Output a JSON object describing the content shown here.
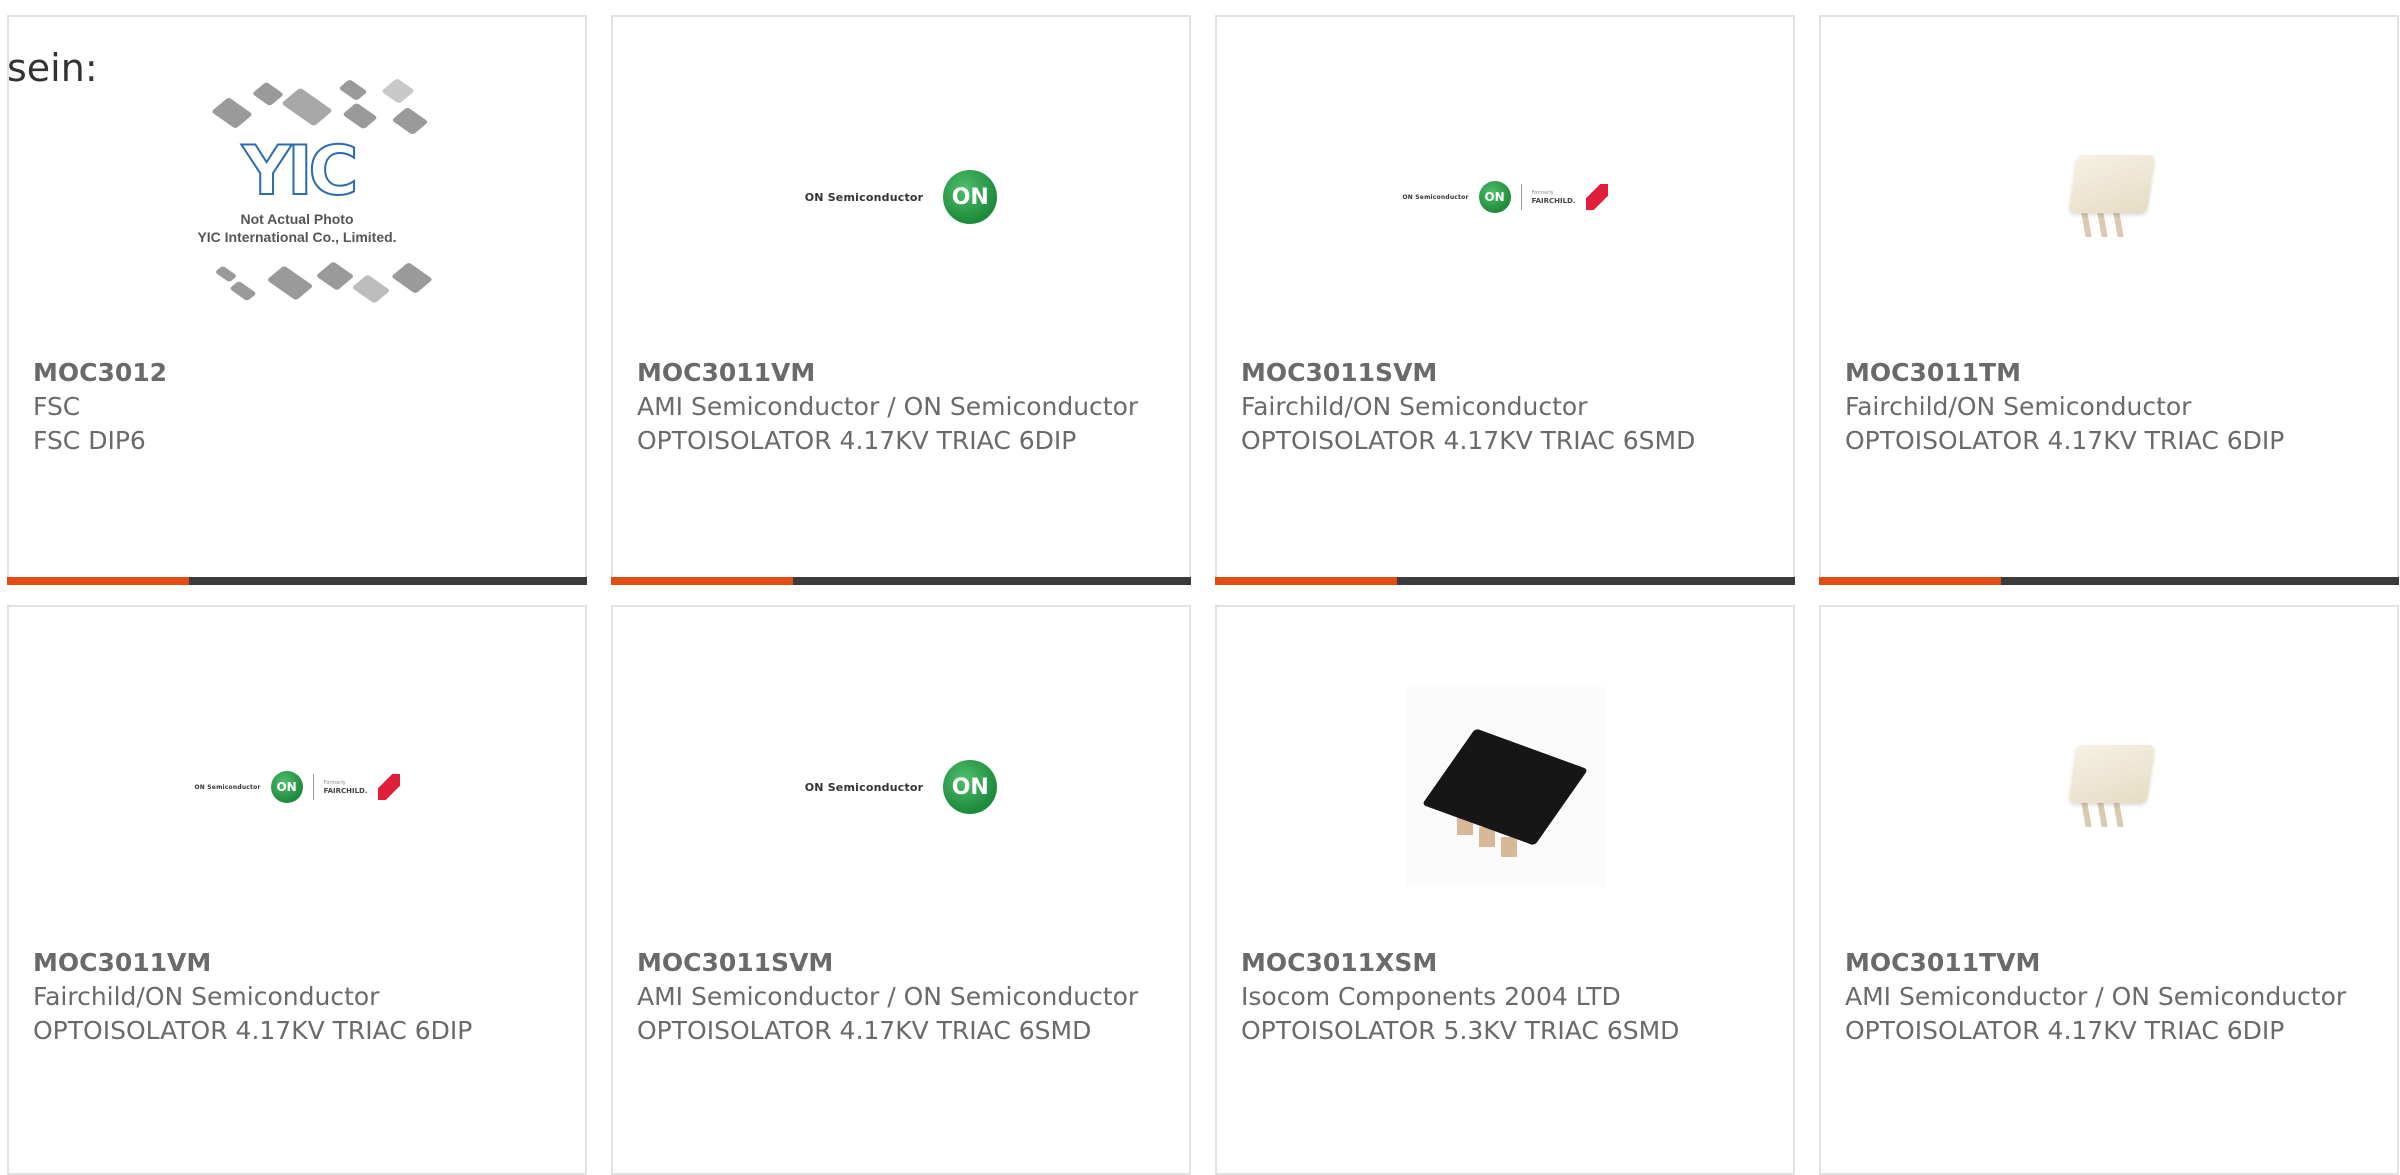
{
  "intro_text": "sein:",
  "placeholder": {
    "logo_text": "YIC",
    "caption_line1": "Not Actual Photo",
    "caption_line2": "YIC International Co., Limited."
  },
  "logos": {
    "on_semi_text": "ON Semiconductor",
    "on_badge": "ON",
    "formerly": "Formerly",
    "fairchild": "FAIRCHILD."
  },
  "colors": {
    "accent": "#e34d14",
    "bar": "#3b3b3b",
    "border": "#e2e2e2",
    "text": "#6a6a6a"
  },
  "products": [
    {
      "part": "MOC3012",
      "manufacturer": "FSC",
      "description": "FSC DIP6",
      "image": "not-actual-photo"
    },
    {
      "part": "MOC3011VM",
      "manufacturer": "AMI Semiconductor / ON Semiconductor",
      "description": "OPTOISOLATOR 4.17KV TRIAC 6DIP",
      "image": "on-semi-logo"
    },
    {
      "part": "MOC3011SVM",
      "manufacturer": "Fairchild/ON Semiconductor",
      "description": "OPTOISOLATOR 4.17KV TRIAC 6SMD",
      "image": "on-fairchild-logo"
    },
    {
      "part": "MOC3011TM",
      "manufacturer": "Fairchild/ON Semiconductor",
      "description": "OPTOISOLATOR 4.17KV TRIAC 6DIP",
      "image": "dip-chip"
    },
    {
      "part": "MOC3011VM",
      "manufacturer": "Fairchild/ON Semiconductor",
      "description": "OPTOISOLATOR 4.17KV TRIAC 6DIP",
      "image": "on-fairchild-logo"
    },
    {
      "part": "MOC3011SVM",
      "manufacturer": "AMI Semiconductor / ON Semiconductor",
      "description": "OPTOISOLATOR 4.17KV TRIAC 6SMD",
      "image": "on-semi-logo"
    },
    {
      "part": "MOC3011XSM",
      "manufacturer": "Isocom Components 2004 LTD",
      "description": "OPTOISOLATOR 5.3KV TRIAC 6SMD",
      "image": "smd-chip"
    },
    {
      "part": "MOC3011TVM",
      "manufacturer": "AMI Semiconductor / ON Semiconductor",
      "description": "OPTOISOLATOR 4.17KV TRIAC 6DIP",
      "image": "dip-chip"
    }
  ]
}
